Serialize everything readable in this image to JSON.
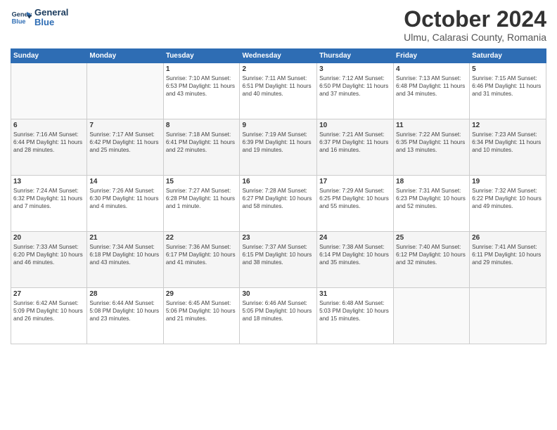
{
  "header": {
    "logo_line1": "General",
    "logo_line2": "Blue",
    "month": "October 2024",
    "location": "Ulmu, Calarasi County, Romania"
  },
  "weekdays": [
    "Sunday",
    "Monday",
    "Tuesday",
    "Wednesday",
    "Thursday",
    "Friday",
    "Saturday"
  ],
  "weeks": [
    [
      {
        "day": "",
        "info": ""
      },
      {
        "day": "",
        "info": ""
      },
      {
        "day": "1",
        "info": "Sunrise: 7:10 AM\nSunset: 6:53 PM\nDaylight: 11 hours and 43 minutes."
      },
      {
        "day": "2",
        "info": "Sunrise: 7:11 AM\nSunset: 6:51 PM\nDaylight: 11 hours and 40 minutes."
      },
      {
        "day": "3",
        "info": "Sunrise: 7:12 AM\nSunset: 6:50 PM\nDaylight: 11 hours and 37 minutes."
      },
      {
        "day": "4",
        "info": "Sunrise: 7:13 AM\nSunset: 6:48 PM\nDaylight: 11 hours and 34 minutes."
      },
      {
        "day": "5",
        "info": "Sunrise: 7:15 AM\nSunset: 6:46 PM\nDaylight: 11 hours and 31 minutes."
      }
    ],
    [
      {
        "day": "6",
        "info": "Sunrise: 7:16 AM\nSunset: 6:44 PM\nDaylight: 11 hours and 28 minutes."
      },
      {
        "day": "7",
        "info": "Sunrise: 7:17 AM\nSunset: 6:42 PM\nDaylight: 11 hours and 25 minutes."
      },
      {
        "day": "8",
        "info": "Sunrise: 7:18 AM\nSunset: 6:41 PM\nDaylight: 11 hours and 22 minutes."
      },
      {
        "day": "9",
        "info": "Sunrise: 7:19 AM\nSunset: 6:39 PM\nDaylight: 11 hours and 19 minutes."
      },
      {
        "day": "10",
        "info": "Sunrise: 7:21 AM\nSunset: 6:37 PM\nDaylight: 11 hours and 16 minutes."
      },
      {
        "day": "11",
        "info": "Sunrise: 7:22 AM\nSunset: 6:35 PM\nDaylight: 11 hours and 13 minutes."
      },
      {
        "day": "12",
        "info": "Sunrise: 7:23 AM\nSunset: 6:34 PM\nDaylight: 11 hours and 10 minutes."
      }
    ],
    [
      {
        "day": "13",
        "info": "Sunrise: 7:24 AM\nSunset: 6:32 PM\nDaylight: 11 hours and 7 minutes."
      },
      {
        "day": "14",
        "info": "Sunrise: 7:26 AM\nSunset: 6:30 PM\nDaylight: 11 hours and 4 minutes."
      },
      {
        "day": "15",
        "info": "Sunrise: 7:27 AM\nSunset: 6:28 PM\nDaylight: 11 hours and 1 minute."
      },
      {
        "day": "16",
        "info": "Sunrise: 7:28 AM\nSunset: 6:27 PM\nDaylight: 10 hours and 58 minutes."
      },
      {
        "day": "17",
        "info": "Sunrise: 7:29 AM\nSunset: 6:25 PM\nDaylight: 10 hours and 55 minutes."
      },
      {
        "day": "18",
        "info": "Sunrise: 7:31 AM\nSunset: 6:23 PM\nDaylight: 10 hours and 52 minutes."
      },
      {
        "day": "19",
        "info": "Sunrise: 7:32 AM\nSunset: 6:22 PM\nDaylight: 10 hours and 49 minutes."
      }
    ],
    [
      {
        "day": "20",
        "info": "Sunrise: 7:33 AM\nSunset: 6:20 PM\nDaylight: 10 hours and 46 minutes."
      },
      {
        "day": "21",
        "info": "Sunrise: 7:34 AM\nSunset: 6:18 PM\nDaylight: 10 hours and 43 minutes."
      },
      {
        "day": "22",
        "info": "Sunrise: 7:36 AM\nSunset: 6:17 PM\nDaylight: 10 hours and 41 minutes."
      },
      {
        "day": "23",
        "info": "Sunrise: 7:37 AM\nSunset: 6:15 PM\nDaylight: 10 hours and 38 minutes."
      },
      {
        "day": "24",
        "info": "Sunrise: 7:38 AM\nSunset: 6:14 PM\nDaylight: 10 hours and 35 minutes."
      },
      {
        "day": "25",
        "info": "Sunrise: 7:40 AM\nSunset: 6:12 PM\nDaylight: 10 hours and 32 minutes."
      },
      {
        "day": "26",
        "info": "Sunrise: 7:41 AM\nSunset: 6:11 PM\nDaylight: 10 hours and 29 minutes."
      }
    ],
    [
      {
        "day": "27",
        "info": "Sunrise: 6:42 AM\nSunset: 5:09 PM\nDaylight: 10 hours and 26 minutes."
      },
      {
        "day": "28",
        "info": "Sunrise: 6:44 AM\nSunset: 5:08 PM\nDaylight: 10 hours and 23 minutes."
      },
      {
        "day": "29",
        "info": "Sunrise: 6:45 AM\nSunset: 5:06 PM\nDaylight: 10 hours and 21 minutes."
      },
      {
        "day": "30",
        "info": "Sunrise: 6:46 AM\nSunset: 5:05 PM\nDaylight: 10 hours and 18 minutes."
      },
      {
        "day": "31",
        "info": "Sunrise: 6:48 AM\nSunset: 5:03 PM\nDaylight: 10 hours and 15 minutes."
      },
      {
        "day": "",
        "info": ""
      },
      {
        "day": "",
        "info": ""
      }
    ]
  ]
}
